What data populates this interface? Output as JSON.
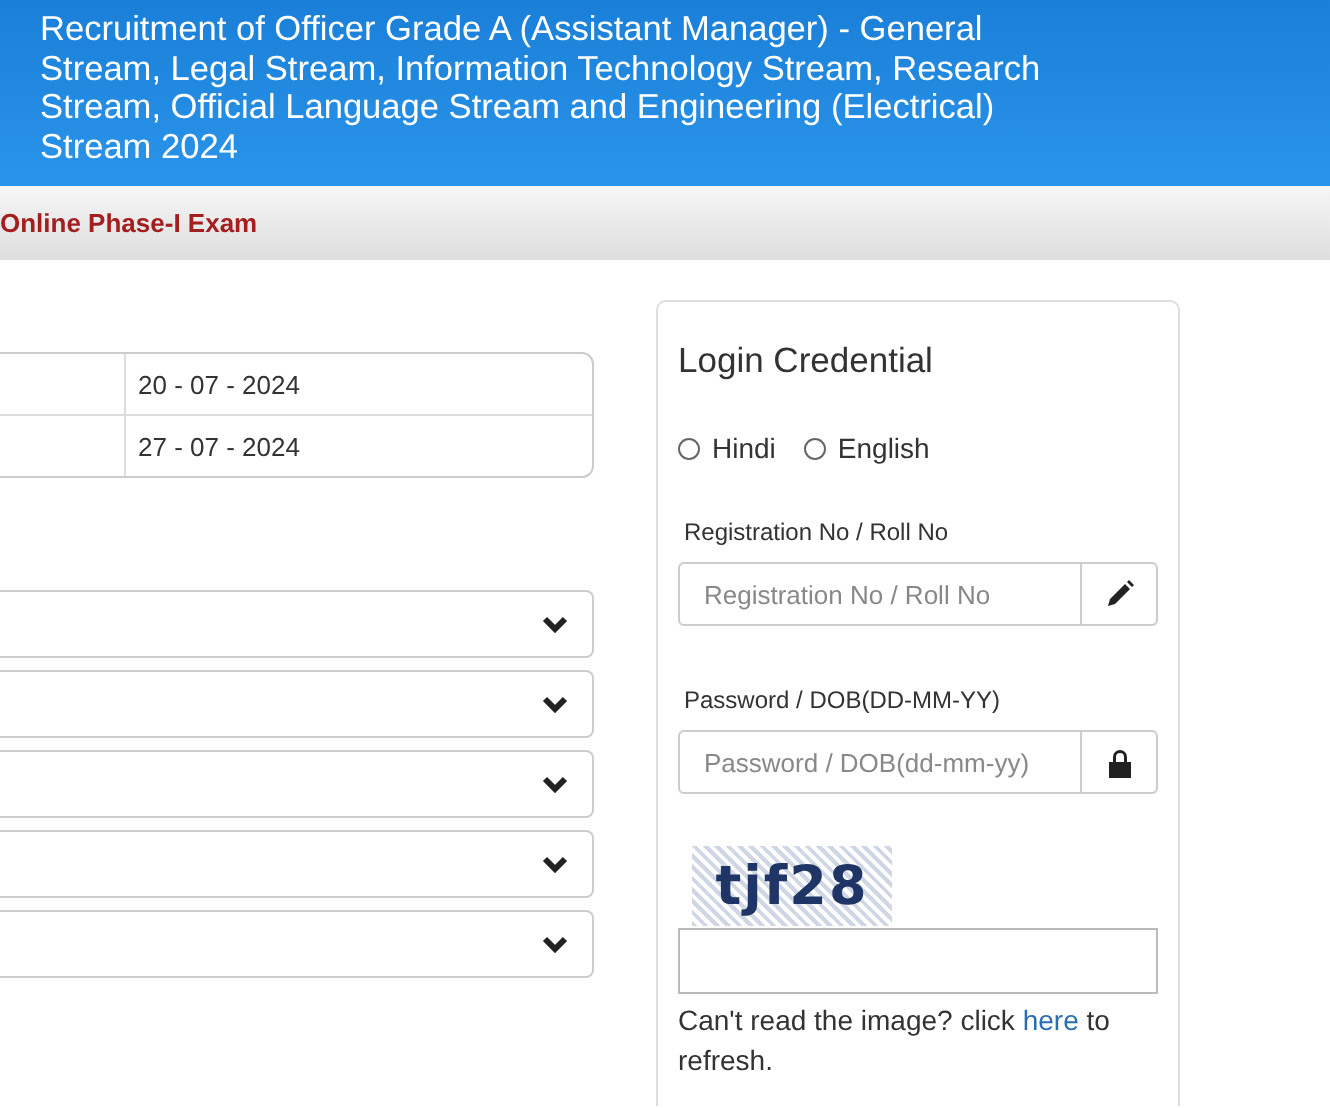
{
  "header": {
    "title": "Recruitment of Officer Grade A (Assistant Manager) - General Stream, Legal Stream, Information Technology Stream, Research Stream, Official Language Stream and Engineering (Electrical) Stream 2024"
  },
  "subheader": {
    "title": "Online Phase-I Exam"
  },
  "schedule": {
    "rows": [
      {
        "column_2": "20 - 07 - 2024"
      },
      {
        "column_2": "27 - 07 - 2024"
      }
    ]
  },
  "dropdowns": [
    {
      "kind": "select"
    },
    {
      "kind": "select"
    },
    {
      "kind": "select"
    },
    {
      "kind": "select"
    },
    {
      "kind": "select"
    }
  ],
  "login": {
    "title": "Login Credential",
    "languages": [
      {
        "label": "Hindi",
        "selected": false
      },
      {
        "label": "English",
        "selected": false
      }
    ],
    "fields": [
      {
        "label": "Registration No / Roll No",
        "placeholder": "Registration No / Roll No",
        "kind": "pencil"
      },
      {
        "label": "Password / DOB(DD-MM-YY)",
        "placeholder": "Password / DOB(dd-mm-yy)",
        "kind": "lock"
      }
    ],
    "captcha": {
      "text": "tjf28"
    },
    "help": {
      "before": "Can't read the image? click ",
      "link": "here",
      "after": " to refresh."
    }
  }
}
